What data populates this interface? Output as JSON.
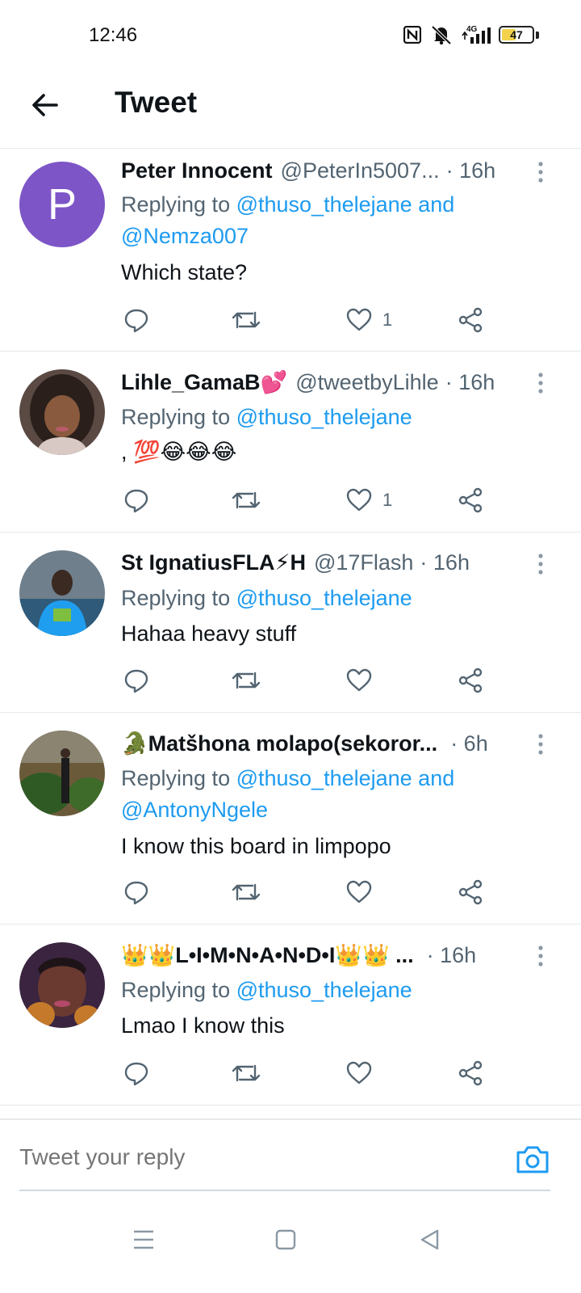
{
  "status_bar": {
    "time": "12:46",
    "network": "4G",
    "battery": "47",
    "battery_level": 0.47
  },
  "header": {
    "title": "Tweet"
  },
  "tweets": [
    {
      "avatar_letter": "P",
      "avatar_color": "#7d55c7",
      "name": "Peter Innocent",
      "handle": "@PeterIn5007...",
      "time": "· 16h",
      "replying_prefix": "Replying to ",
      "mention1": "@thuso_thelejane",
      "joiner": " and",
      "mention2": "@Nemza007",
      "text": "Which state?",
      "likes": "1"
    },
    {
      "name": "Lihle_GamaB💕",
      "handle": "@tweetbyLihle",
      "time": "· 16h",
      "replying_prefix": "Replying to ",
      "mention1": "@thuso_thelejane",
      "text": ", 💯😂😂😂",
      "likes": "1"
    },
    {
      "name": "St IgnatiusFLA⚡H",
      "handle": "@17Flash",
      "time": "· 16h",
      "replying_prefix": "Replying to ",
      "mention1": "@thuso_thelejane",
      "text": "Hahaa heavy stuff",
      "likes": ""
    },
    {
      "name": "🐊Matšhona molapo(sekoror...",
      "handle": "",
      "time": "· 6h",
      "replying_prefix": "Replying to ",
      "mention1": "@thuso_thelejane",
      "joiner": " and",
      "mention2": "@AntonyNgele",
      "text": "I know this board in limpopo",
      "likes": ""
    },
    {
      "name": "👑👑L•I•M•N•A•N•D•I👑👑 ...",
      "handle": "",
      "time": "· 16h",
      "replying_prefix": "Replying to ",
      "mention1": "@thuso_thelejane",
      "text": "Lmao I know this",
      "likes": ""
    }
  ],
  "reply_bar": {
    "placeholder": "Tweet your reply"
  },
  "colors": {
    "accent": "#1d9bf0",
    "secondary_text": "#536471",
    "divider": "#e6e8ea"
  }
}
